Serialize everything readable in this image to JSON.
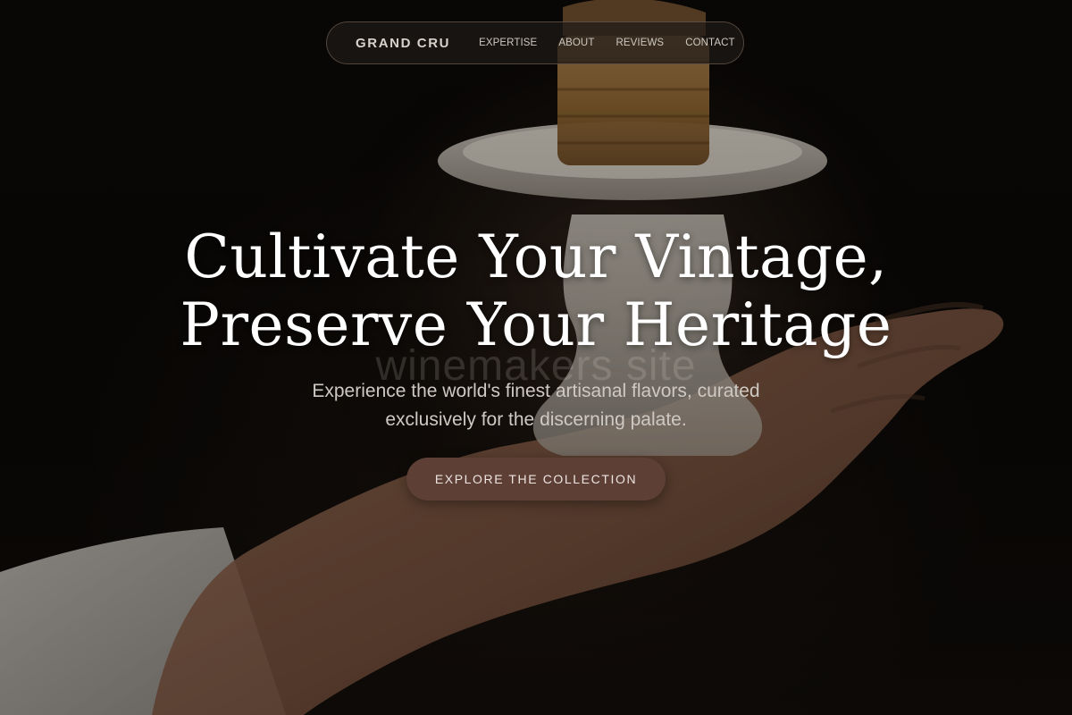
{
  "nav": {
    "brand": "GRAND CRU",
    "links": [
      "EXPERTISE",
      "ABOUT",
      "REVIEWS",
      "CONTACT"
    ]
  },
  "hero": {
    "headline_line1": "Cultivate Your Vintage,",
    "headline_line2": "Preserve Your Heritage",
    "watermark": "winemakers site",
    "subtitle": "Experience the world's finest artisanal flavors, curated exclusively for the discerning palate.",
    "cta_label": "EXPLORE THE COLLECTION",
    "image_icon": "hand-holding-pastry-on-cake-stand-photo"
  },
  "colors": {
    "background": "#0b0907",
    "cta": "#5d3f36",
    "nav_border": "#be a08c",
    "headline": "#ffffff"
  }
}
